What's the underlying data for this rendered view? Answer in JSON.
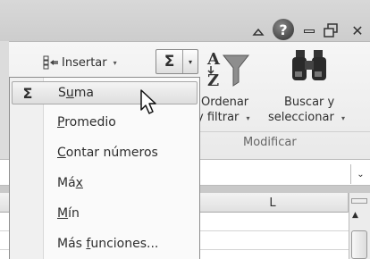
{
  "window_controls": {
    "help_label": "?",
    "close_glyph": "✕"
  },
  "ribbon": {
    "insert_label": "Insertar",
    "sum_symbol": "Σ",
    "sort_label_line1": "Ordenar",
    "sort_label_line2": "y filtrar",
    "find_label_line1": "Buscar y",
    "find_label_line2": "seleccionar",
    "group_label": "Modificar",
    "dropdown_arrow": "▾"
  },
  "sheet": {
    "column_header": "L",
    "scroll_up": "▲",
    "formula_dropdown": "⌄"
  },
  "menu": {
    "items": [
      {
        "symbol": "Σ",
        "label_pre": "S",
        "label_u": "u",
        "label_post": "ma"
      },
      {
        "symbol": "",
        "label_pre": "",
        "label_u": "P",
        "label_post": "romedio"
      },
      {
        "symbol": "",
        "label_pre": "",
        "label_u": "C",
        "label_post": "ontar números"
      },
      {
        "symbol": "",
        "label_pre": "Má",
        "label_u": "x",
        "label_post": ""
      },
      {
        "symbol": "",
        "label_pre": "",
        "label_u": "M",
        "label_post": "ín"
      },
      {
        "symbol": "",
        "label_pre": "Más ",
        "label_u": "f",
        "label_post": "unciones..."
      }
    ]
  },
  "colors": {
    "accent": "#2f6fbf"
  }
}
